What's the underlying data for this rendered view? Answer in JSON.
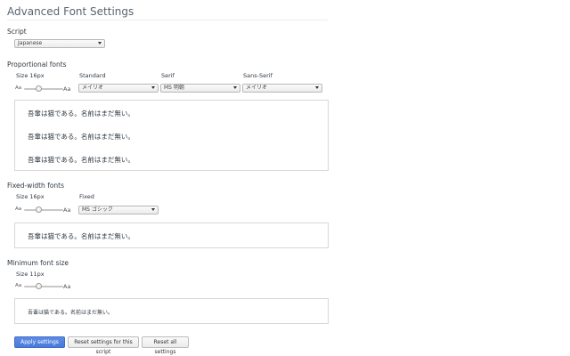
{
  "page": {
    "title": "Advanced Font Settings"
  },
  "script": {
    "label": "Script",
    "selected": "Japanese"
  },
  "proportional": {
    "heading": "Proportional fonts",
    "size_label": "Size 16px",
    "size_fraction": 0.35,
    "aa_small": "Aa",
    "aa_big": "Aa",
    "standard": {
      "label": "Standard",
      "selected": "メイリオ"
    },
    "serif": {
      "label": "Serif",
      "selected": "MS 明朝"
    },
    "sans_serif": {
      "label": "Sans-Serif",
      "selected": "メイリオ"
    },
    "preview_lines": [
      "吾輩は猫である。名前はまだ無い。",
      "吾輩は猫である。名前はまだ無い。",
      "吾輩は猫である。名前はまだ無い。"
    ]
  },
  "fixed": {
    "heading": "Fixed-width fonts",
    "size_label": "Size 16px",
    "size_fraction": 0.35,
    "aa_small": "Aa",
    "aa_big": "Aa",
    "font": {
      "label": "Fixed",
      "selected": "MS ゴシック"
    },
    "preview_line": "吾輩は猫である。名前はまだ無い。"
  },
  "minimum": {
    "heading": "Minimum font size",
    "size_label": "Size 11px",
    "size_fraction": 0.35,
    "aa_small": "Aa",
    "aa_big": "Aa",
    "preview_line": "吾輩は猫である。名前はまだ無い。"
  },
  "buttons": {
    "apply": "Apply settings",
    "reset_script": "Reset settings for this script",
    "reset_all": "Reset all settings"
  },
  "colors": {
    "primary_button": "#4a7ad8"
  }
}
